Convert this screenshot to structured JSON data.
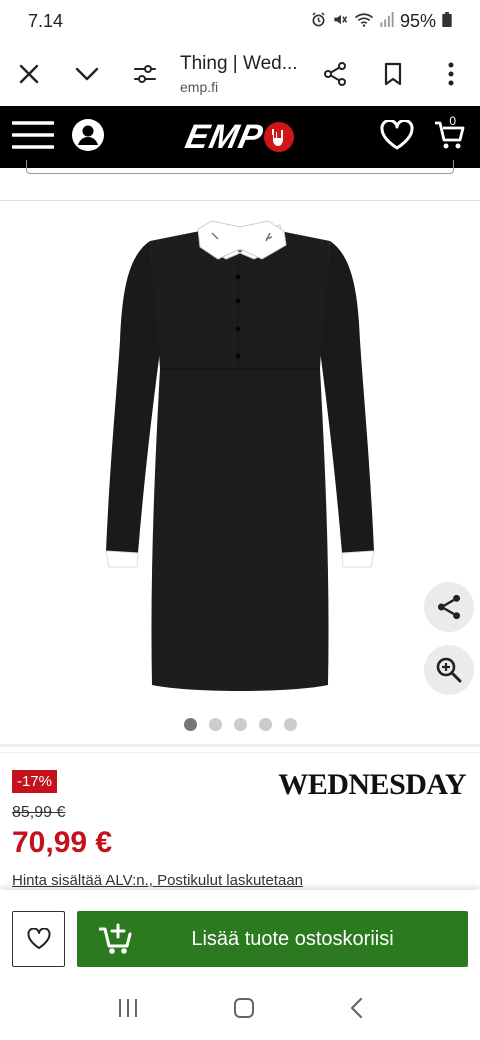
{
  "status_bar": {
    "time": "7.14",
    "battery": "95%",
    "icons": [
      "alarm-icon",
      "mute-icon",
      "wifi-icon",
      "signal-icon",
      "battery-icon"
    ]
  },
  "browser": {
    "page_title": "Thing | Wed...",
    "domain": "emp.fi",
    "icons": [
      "close-icon",
      "chevron-down-icon",
      "tune-icon",
      "share-icon",
      "bookmark-icon",
      "more-vert-icon"
    ]
  },
  "site_header": {
    "logo_text": "EMP",
    "cart_count": "0",
    "icons": [
      "menu-icon",
      "account-icon",
      "heart-icon",
      "cart-icon"
    ]
  },
  "gallery": {
    "image_name": "black long-sleeve dress with white collar and cuffs",
    "dot_count": 5,
    "active_index": 0,
    "icons": [
      "share-icon",
      "zoom-in-icon"
    ]
  },
  "product": {
    "discount_badge": "-17%",
    "brand_logo": "WEDNESDAY",
    "old_price": "85,99 €",
    "new_price": "70,99 €",
    "vat_note": "Hinta sisältää ALV:n., Postikulut laskutetaan"
  },
  "action_bar": {
    "add_to_cart_label": "Lisää tuote ostoskoriisi",
    "icons": [
      "heart-outline-icon",
      "add-to-cart-icon"
    ]
  },
  "colors": {
    "header_bg": "#000000",
    "brand_red": "#c3121b",
    "cart_green": "#2b7a1f",
    "float_button_bg": "#ebebeb"
  },
  "android_nav": {
    "icons": [
      "recents-icon",
      "home-icon",
      "back-icon"
    ]
  }
}
